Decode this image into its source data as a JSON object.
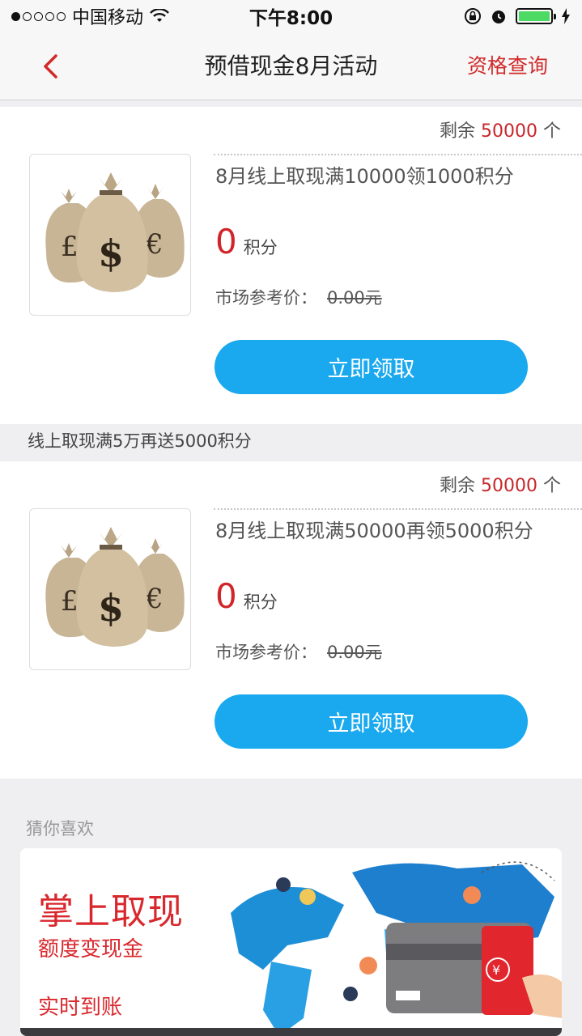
{
  "status_bar": {
    "carrier": "中国移动",
    "time": "下午8:00"
  },
  "nav": {
    "title": "预借现金8月活动",
    "action": "资格查询"
  },
  "cards": [
    {
      "remain_prefix": "剩余",
      "remain_count": "50000",
      "remain_suffix": "个",
      "title": "8月线上取现满10000领1000积分",
      "points": "0",
      "points_unit": "积分",
      "market_label": "市场参考价：",
      "market_price": "0.00元",
      "button": "立即领取"
    },
    {
      "remain_prefix": "剩余",
      "remain_count": "50000",
      "remain_suffix": "个",
      "title": "8月线上取现满50000再领5000积分",
      "points": "0",
      "points_unit": "积分",
      "market_label": "市场参考价：",
      "market_price": "0.00元",
      "button": "立即领取"
    }
  ],
  "section_heading": "线上取现满5万再送5000积分",
  "guess": {
    "label": "猜你喜欢"
  },
  "banner": {
    "line1": "掌上取现",
    "line2": "额度变现金",
    "line3": "实时到账"
  },
  "colors": {
    "accent_red": "#d02a2a",
    "button_blue": "#1aa9ef"
  }
}
